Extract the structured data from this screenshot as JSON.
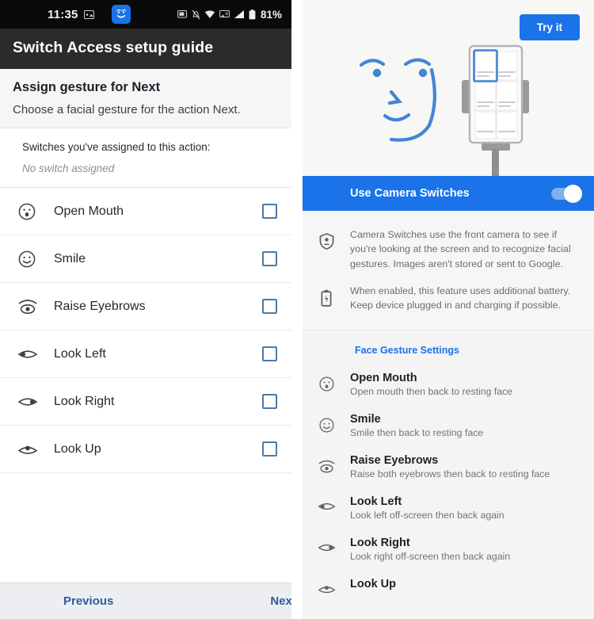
{
  "left": {
    "statusbar": {
      "time": "11:35",
      "battery": "81%",
      "icons": [
        "message-icon",
        "face-chip-icon",
        "screenshot-icon",
        "notifications-off-icon",
        "wifi-icon",
        "cast-icon",
        "signal-icon",
        "battery-icon"
      ]
    },
    "appbar": {
      "title": "Switch Access setup guide"
    },
    "section": {
      "title": "Assign gesture for Next",
      "subtitle": "Choose a facial gesture for the action Next."
    },
    "assigned": {
      "label": "Switches you've assigned to this action:",
      "value": "No switch assigned"
    },
    "gestures": [
      {
        "icon": "open-mouth-face-icon",
        "label": "Open Mouth",
        "checked": false
      },
      {
        "icon": "smile-face-icon",
        "label": "Smile",
        "checked": false
      },
      {
        "icon": "raise-eyebrows-eye-icon",
        "label": "Raise Eyebrows",
        "checked": false
      },
      {
        "icon": "look-left-eye-icon",
        "label": "Look Left",
        "checked": false
      },
      {
        "icon": "look-right-eye-icon",
        "label": "Look Right",
        "checked": false
      },
      {
        "icon": "look-up-eye-icon",
        "label": "Look Up",
        "checked": false
      }
    ],
    "bottom": {
      "previous": "Previous",
      "next": "Next"
    }
  },
  "right": {
    "hero": {
      "try_button": "Try it",
      "illustration": "face-and-phone-on-stand-illustration"
    },
    "toggle": {
      "label": "Use Camera Switches",
      "state": "on"
    },
    "info": [
      {
        "icon": "privacy-shield-icon",
        "text": "Camera Switches use the front camera to see if you're looking at the screen and to recognize facial gestures. Images aren't stored or sent to Google."
      },
      {
        "icon": "battery-icon",
        "text": "When enabled, this feature uses additional battery. Keep device plugged in and charging if possible."
      }
    ],
    "settings": {
      "title": "Face Gesture Settings",
      "items": [
        {
          "icon": "open-mouth-face-icon",
          "title": "Open Mouth",
          "desc": "Open mouth then back to resting face"
        },
        {
          "icon": "smile-face-icon",
          "title": "Smile",
          "desc": "Smile then back to resting face"
        },
        {
          "icon": "raise-eyebrows-eye-icon",
          "title": "Raise Eyebrows",
          "desc": "Raise both eyebrows then back to resting face"
        },
        {
          "icon": "look-left-eye-icon",
          "title": "Look Left",
          "desc": "Look left off-screen then back again"
        },
        {
          "icon": "look-right-eye-icon",
          "title": "Look Right",
          "desc": "Look right off-screen then back again"
        },
        {
          "icon": "look-up-eye-icon",
          "title": "Look Up",
          "desc": ""
        }
      ]
    }
  },
  "colors": {
    "accent_blue": "#1a73e8",
    "appbar_dark": "#2b2b2b",
    "statusbar_black": "#0a0a0a",
    "page_gray": "#eceef1",
    "checkbox_border": "#4b7ba8",
    "link_blue": "#2d5e9e"
  }
}
